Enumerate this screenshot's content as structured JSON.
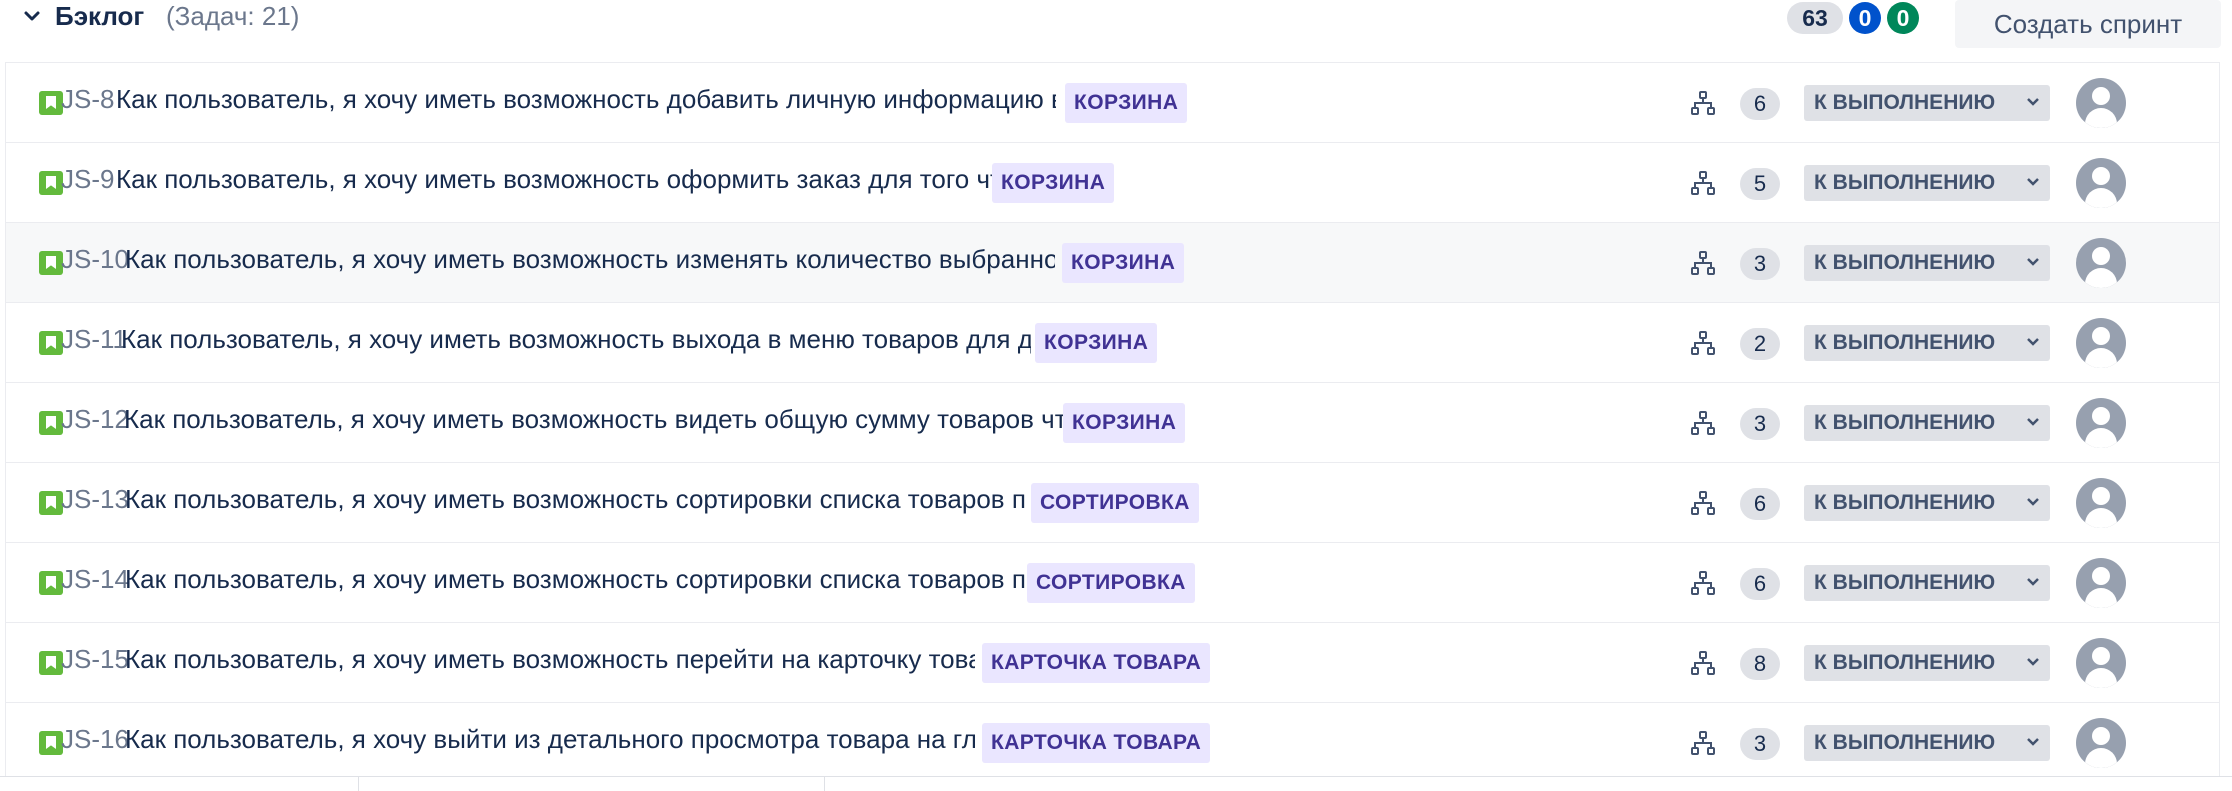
{
  "header": {
    "title": "Бэклог",
    "task_count": "(Задач: 21)",
    "counts": {
      "todo": "63",
      "in_progress": "0",
      "done": "0"
    },
    "create_sprint": "Создать спринт"
  },
  "colors": {
    "story_icon": "#63ba3c",
    "epic_bg": "#eae6ff",
    "epic_text": "#403294",
    "badge_blue": "#0052cc",
    "badge_green": "#00875a",
    "badge_grey": "#dfe1e6"
  },
  "issues": [
    {
      "key": "JS-8",
      "summary": "Как пользователь, я хочу иметь возможность добавить личную информацию в корзине для офо…",
      "epic": "КОРЗИНА",
      "subtasks": "6",
      "status": "К ВЫПОЛНЕНИЮ",
      "icon": "story-icon"
    },
    {
      "key": "JS-9",
      "summary": "Как пользователь, я хочу иметь возможность оформить заказ для того чтобы купить товар",
      "epic": "КОРЗИНА",
      "subtasks": "5",
      "status": "К ВЫПОЛНЕНИЮ",
      "icon": "story-icon"
    },
    {
      "key": "JS-10",
      "summary": "Как пользователь, я хочу иметь возможность изменять количество выбранного товара для нео…",
      "epic": "КОРЗИНА",
      "subtasks": "3",
      "status": "К ВЫПОЛНЕНИЮ",
      "icon": "story-icon"
    },
    {
      "key": "JS-11",
      "summary": "Как пользователь, я хочу иметь возможность выхода в меню товаров для дальнейших покупок",
      "epic": "КОРЗИНА",
      "subtasks": "2",
      "status": "К ВЫПОЛНЕНИЮ",
      "icon": "story-icon"
    },
    {
      "key": "JS-12",
      "summary": "Как пользователь, я хочу иметь возможность видеть общую сумму товаров чтобы их приобрести",
      "epic": "КОРЗИНА",
      "subtasks": "3",
      "status": "К ВЫПОЛНЕНИЮ",
      "icon": "story-icon"
    },
    {
      "key": "JS-13",
      "summary": "Как пользователь, я хочу иметь возможность сортировки списка товаров по алфавиту чтоб…",
      "epic": "СОРТИРОВКА",
      "subtasks": "6",
      "status": "К ВЫПОЛНЕНИЮ",
      "icon": "story-icon"
    },
    {
      "key": "JS-14",
      "summary": "Как пользователь, я хочу иметь возможность сортировки списка товаров по цене чтобы бы…",
      "epic": "СОРТИРОВКА",
      "subtasks": "6",
      "status": "К ВЫПОЛНЕНИЮ",
      "icon": "story-icon"
    },
    {
      "key": "JS-15",
      "summary": "Как пользователь, я хочу иметь возможность перейти на карточку товара для детальн…",
      "epic": "КАРТОЧКА ТОВАРА",
      "subtasks": "8",
      "status": "К ВЫПОЛНЕНИЮ",
      "icon": "story-icon"
    },
    {
      "key": "JS-16",
      "summary": "Как пользователь, я хочу выйти из детального просмотра товара на главную страницу …",
      "epic": "КАРТОЧКА ТОВАРА",
      "subtasks": "3",
      "status": "К ВЫПОЛНЕНИЮ",
      "icon": "story-icon"
    }
  ]
}
